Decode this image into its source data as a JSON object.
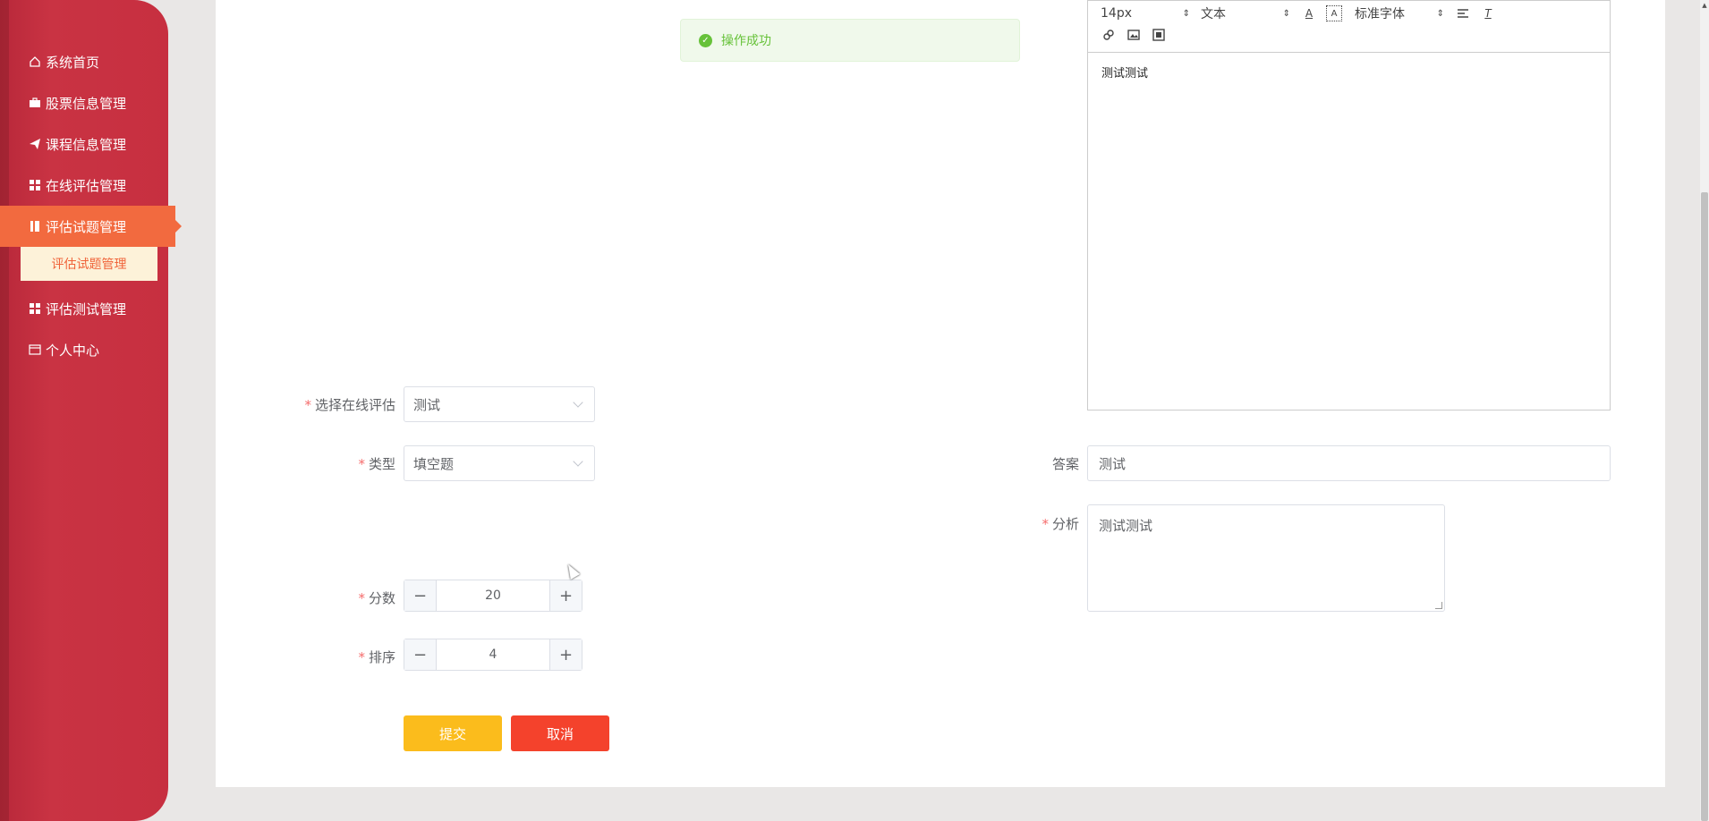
{
  "sidebar": {
    "items": [
      {
        "label": "系统首页",
        "icon": "home-icon"
      },
      {
        "label": "股票信息管理",
        "icon": "briefcase-icon"
      },
      {
        "label": "课程信息管理",
        "icon": "paper-plane-icon"
      },
      {
        "label": "在线评估管理",
        "icon": "grid-icon"
      },
      {
        "label": "评估试题管理",
        "icon": "book-icon",
        "active": true
      },
      {
        "label": "评估测试管理",
        "icon": "grid-icon"
      },
      {
        "label": "个人中心",
        "icon": "card-icon"
      }
    ],
    "submenu_label": "评估试题管理"
  },
  "toast": {
    "message": "操作成功",
    "type": "success"
  },
  "editor": {
    "font_size": "14px",
    "text_style": "文本",
    "font_family": "标准字体",
    "content": "测试测试"
  },
  "form": {
    "assessment_label": "选择在线评估",
    "assessment_value": "测试",
    "type_label": "类型",
    "type_value": "填空题",
    "answer_label": "答案",
    "answer_value": "测试",
    "analysis_label": "分析",
    "analysis_value": "测试测试",
    "score_label": "分数",
    "score_value": "20",
    "order_label": "排序",
    "order_value": "4",
    "submit_label": "提交",
    "cancel_label": "取消"
  },
  "colors": {
    "sidebar": "#c72f40",
    "active_item": "#f26a3f",
    "submit": "#fbbc1c",
    "cancel": "#f4422c",
    "success": "#67c23a"
  }
}
